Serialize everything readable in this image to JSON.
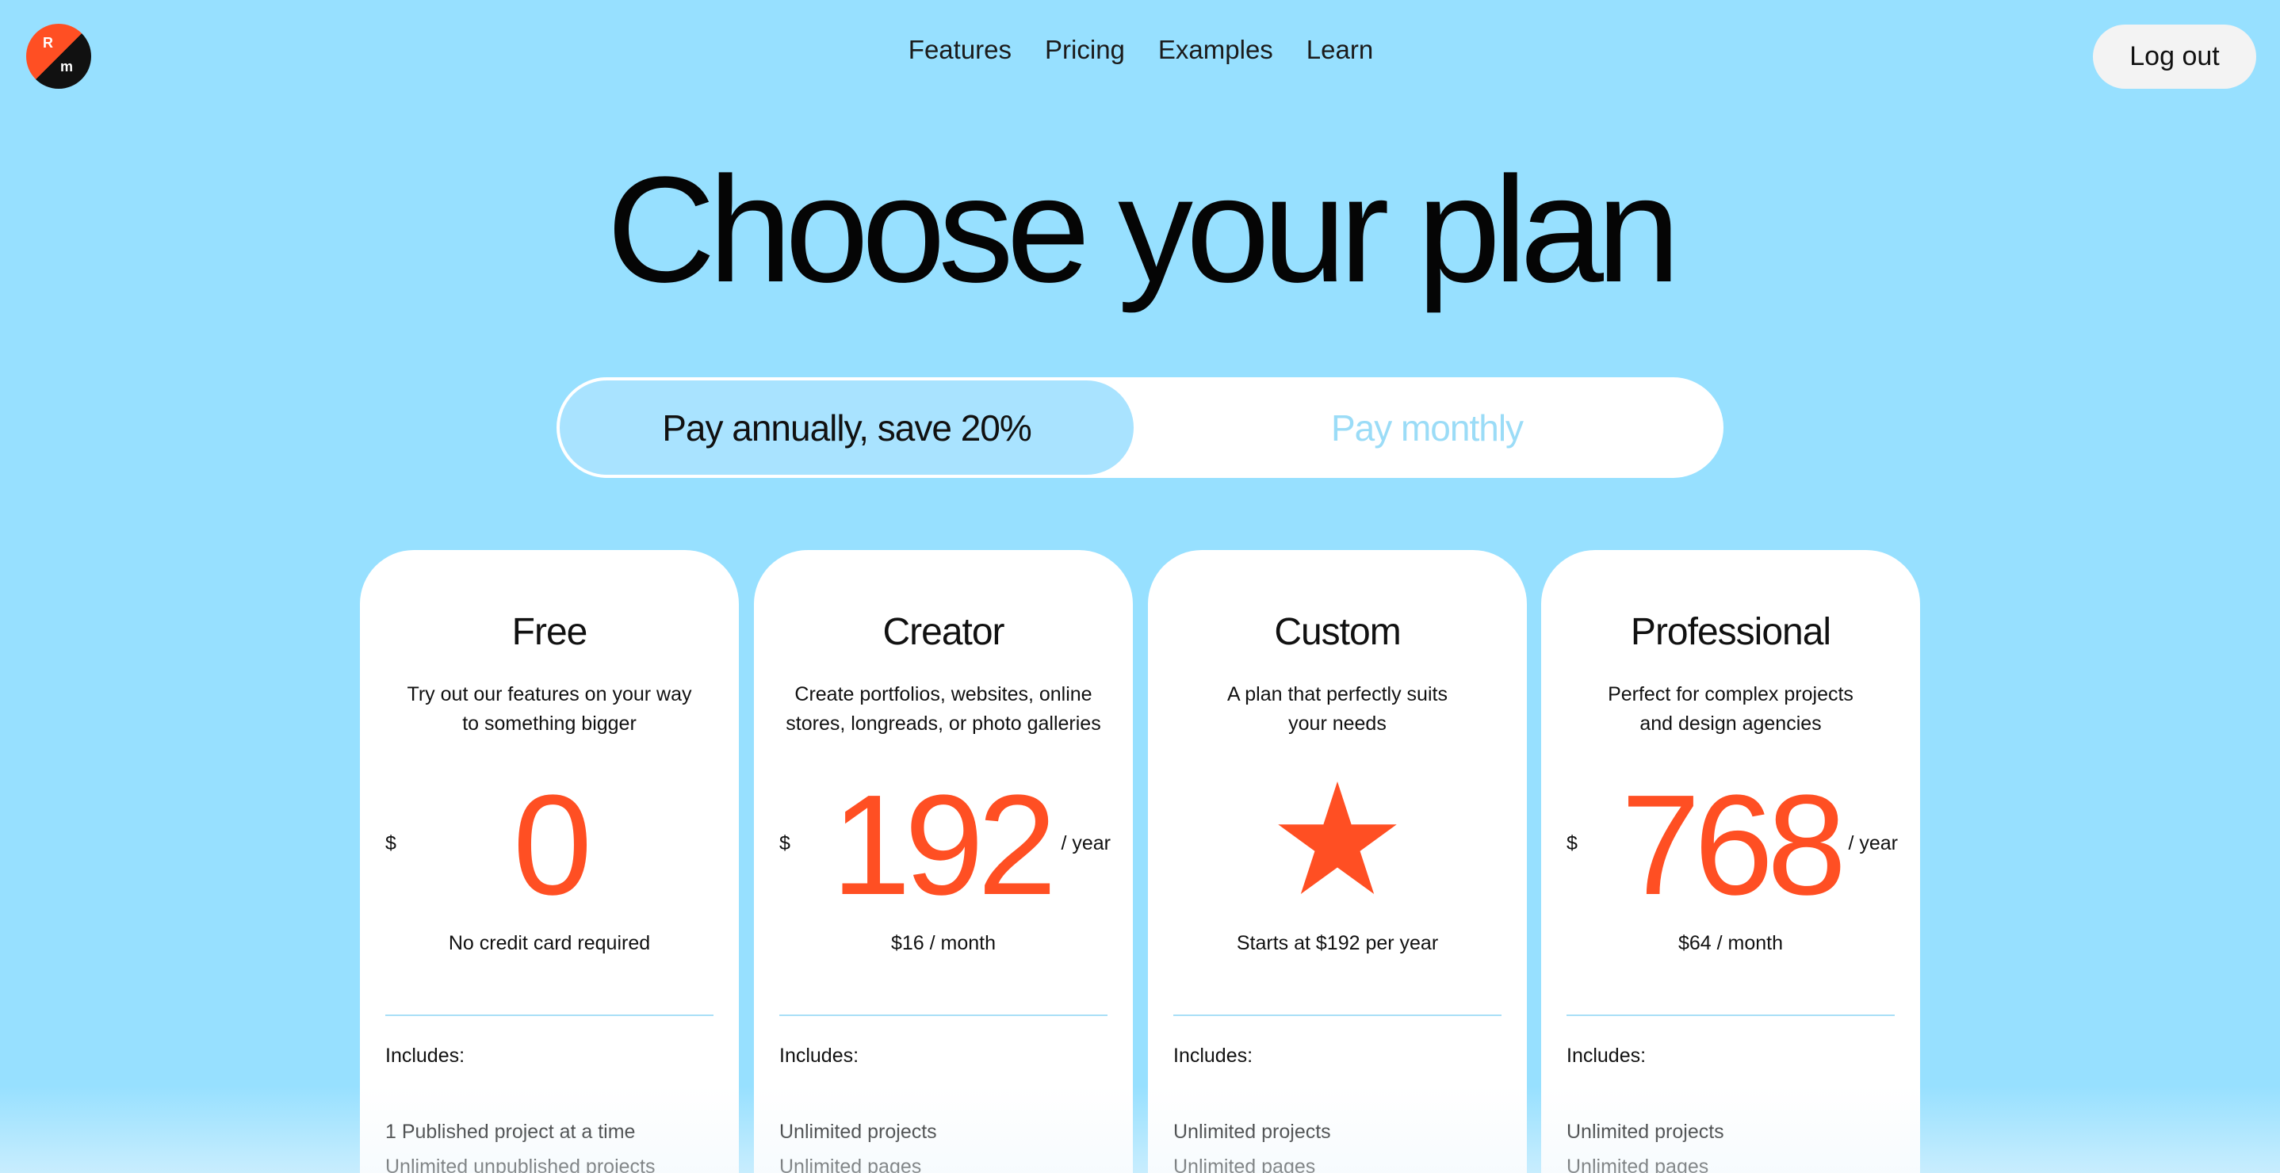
{
  "logo": {
    "top_letter": "R",
    "bottom_letter": "m",
    "colors": [
      "#ff4f23",
      "#111111"
    ]
  },
  "nav": {
    "items": [
      {
        "label": "Features"
      },
      {
        "label": "Pricing"
      },
      {
        "label": "Examples"
      },
      {
        "label": "Learn"
      }
    ],
    "logout_label": "Log out"
  },
  "hero": {
    "title": "Choose your plan"
  },
  "billing_toggle": {
    "annual_label": "Pay annually, save 20%",
    "monthly_label": "Pay monthly",
    "selected": "annual"
  },
  "plans": [
    {
      "name": "Free",
      "description": "Try out our features on your way to something bigger",
      "currency": "$",
      "price": "0",
      "period": "",
      "note": "No credit card required",
      "includes_label": "Includes:",
      "features": [
        "1 Published project at a time",
        "Unlimited unpublished projects"
      ]
    },
    {
      "name": "Creator",
      "description": "Create portfolios, websites, online stores, longreads, or photo galleries",
      "currency": "$",
      "price": "192",
      "period": "/ year",
      "note": "$16 / month",
      "includes_label": "Includes:",
      "features": [
        "Unlimited projects",
        "Unlimited pages"
      ]
    },
    {
      "name": "Custom",
      "description": "A plan that perfectly suits your needs",
      "icon": "star-icon",
      "note": "Starts at $192 per year",
      "includes_label": "Includes:",
      "features": [
        "Unlimited projects",
        "Unlimited pages"
      ]
    },
    {
      "name": "Professional",
      "description": "Perfect for complex projects and design agencies",
      "currency": "$",
      "price": "768",
      "period": "/ year",
      "note": "$64 / month",
      "includes_label": "Includes:",
      "features": [
        "Unlimited projects",
        "Unlimited pages"
      ]
    }
  ],
  "colors": {
    "background": "#97e0ff",
    "accent": "#ff4f23",
    "toggle_active": "#a9e3ff",
    "toggle_inactive_text": "#9bdcf7"
  }
}
